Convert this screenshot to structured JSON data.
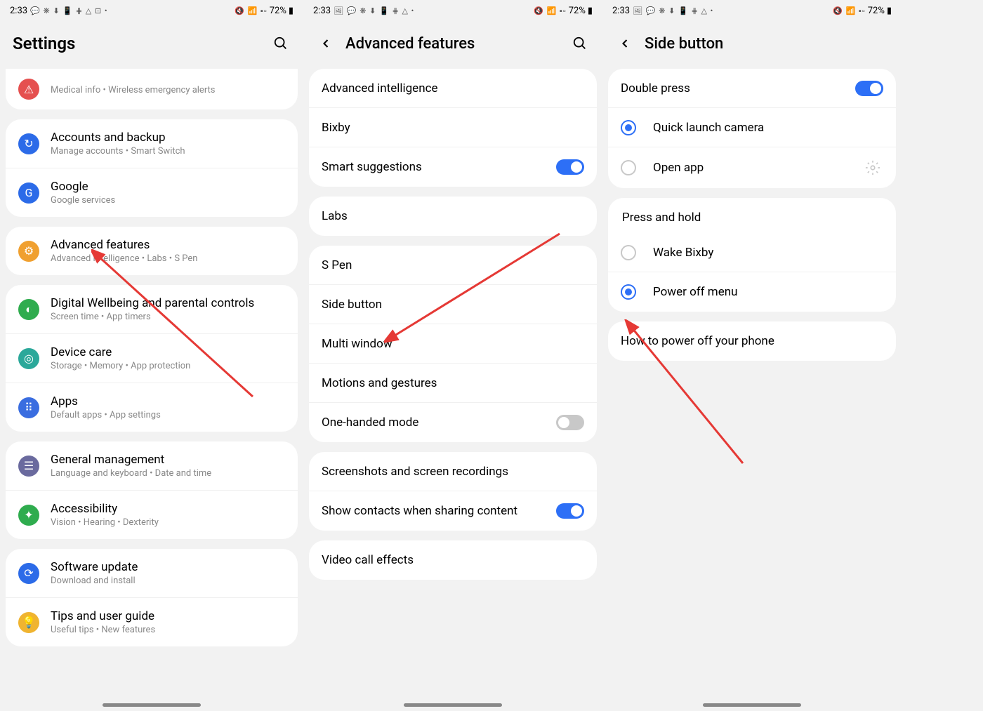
{
  "status": {
    "time": "2:33",
    "battery": "72%"
  },
  "panel1": {
    "title": "Settings",
    "items": [
      {
        "title": "Medical info  •  Wireless emergency alerts"
      },
      {
        "title": "Accounts and backup",
        "sub": "Manage accounts  •  Smart Switch"
      },
      {
        "title": "Google",
        "sub": "Google services"
      },
      {
        "title": "Advanced features",
        "sub": "Advanced intelligence  •  Labs  •  S Pen"
      },
      {
        "title": "Digital Wellbeing and parental controls",
        "sub": "Screen time  •  App timers"
      },
      {
        "title": "Device care",
        "sub": "Storage  •  Memory  •  App protection"
      },
      {
        "title": "Apps",
        "sub": "Default apps  •  App settings"
      },
      {
        "title": "General management",
        "sub": "Language and keyboard  •  Date and time"
      },
      {
        "title": "Accessibility",
        "sub": "Vision  •  Hearing  •  Dexterity"
      },
      {
        "title": "Software update",
        "sub": "Download and install"
      },
      {
        "title": "Tips and user guide",
        "sub": "Useful tips  •  New features"
      }
    ]
  },
  "panel2": {
    "title": "Advanced features",
    "g1": [
      "Advanced intelligence",
      "Bixby",
      "Smart suggestions"
    ],
    "g2": [
      "Labs"
    ],
    "g3": [
      "S Pen",
      "Side button",
      "Multi window",
      "Motions and gestures",
      "One-handed mode"
    ],
    "g4": [
      "Screenshots and screen recordings",
      "Show contacts when sharing content"
    ],
    "g5": [
      "Video call effects"
    ]
  },
  "panel3": {
    "title": "Side button",
    "double_press": "Double press",
    "opt1": "Quick launch camera",
    "opt2": "Open app",
    "press_hold": "Press and hold",
    "opt3": "Wake Bixby",
    "opt4": "Power off menu",
    "howto": "How to power off your phone"
  }
}
